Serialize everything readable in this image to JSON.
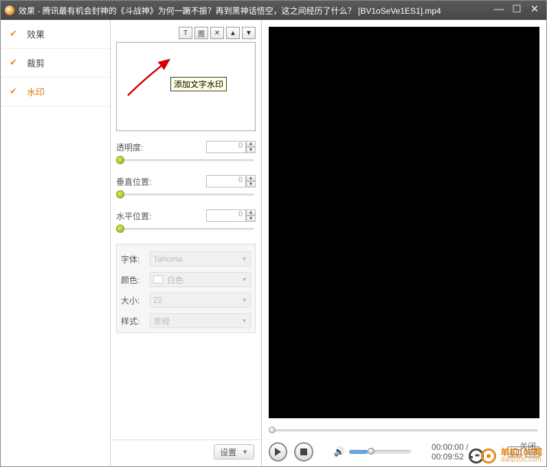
{
  "window": {
    "title": "效果 - 腾讯最有机会封神的《斗战神》为何一蹶不振？再到黑神话悟空，这之间经历了什么？ [BV1oSeVe1ES1].mp4"
  },
  "tabs": [
    {
      "label": "效果"
    },
    {
      "label": "裁剪"
    },
    {
      "label": "水印"
    }
  ],
  "toolbar": {
    "btn_text": "T",
    "btn_image": "图",
    "btn_delete": "✕",
    "btn_up": "▲",
    "btn_down": "▼",
    "tooltip": "添加文字水印"
  },
  "sliders": {
    "opacity": {
      "label": "透明度:",
      "value": "0"
    },
    "vpos": {
      "label": "垂直位置:",
      "value": "0"
    },
    "hpos": {
      "label": "水平位置:",
      "value": "0"
    }
  },
  "font": {
    "font_label": "字体:",
    "font_value": "Tahoma",
    "color_label": "颜色:",
    "color_value": "白色",
    "size_label": "大小:",
    "size_value": "22",
    "style_label": "样式:",
    "style_value": "常规"
  },
  "settings": {
    "button": "设置"
  },
  "player": {
    "time_current": "00:00:00",
    "time_total": "00:09:52",
    "time_sep": " / "
  },
  "footer": {
    "brand_main": "单机100网",
    "brand_sub": "danji100.com",
    "close_label": "关闭"
  }
}
